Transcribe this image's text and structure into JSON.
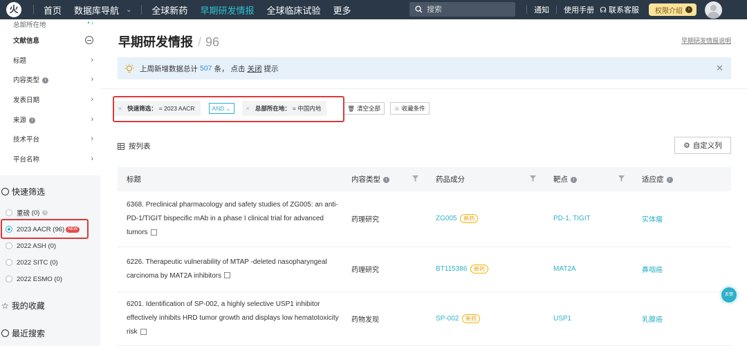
{
  "topnav": {
    "logo": "火",
    "items": [
      "首页",
      "数据库导航",
      "全球新药",
      "早期研发情报",
      "全球临床试验",
      "更多"
    ],
    "active_index": 3,
    "search_placeholder": "搜索",
    "right_items": [
      "通知",
      "使用手册",
      "联系客服"
    ],
    "privilege_label": "权限介绍"
  },
  "sidebar": {
    "top_item": "总部所在地",
    "doc_section": "文献信息",
    "rows": [
      "标题",
      "内容类型",
      "发表日期",
      "来源",
      "技术平台",
      "平台名称"
    ],
    "quick_filter_title": "快速筛选",
    "radios": [
      {
        "label": "重磅",
        "count": "(0)"
      },
      {
        "label": "2023 AACR",
        "count": "(96)",
        "badge": "NEW"
      },
      {
        "label": "2022 ASH",
        "count": "(0)"
      },
      {
        "label": "2022 SITC",
        "count": "(0)"
      },
      {
        "label": "2022 ESMO",
        "count": "(0)"
      }
    ],
    "favorites_title": "我的收藏",
    "recent_title": "最近搜索"
  },
  "main": {
    "title": "早期研发情报",
    "count": "96",
    "help_link": "早期研发情报说明",
    "notice": {
      "prefix": "上周新增数据总计",
      "number": "507",
      "mid": "条， 点击",
      "close": "关闭",
      "suffix": "提示"
    },
    "filters": {
      "chip1_label": "快速筛选：",
      "chip1_value": "= 2023 AACR",
      "operator": "AND",
      "chip2_label": "总部所在地：",
      "chip2_value": "= 中国内地",
      "clear_all": "清空全部",
      "save_filter": "收藏条件"
    },
    "list_label": "按列表",
    "custom_columns": "自定义列"
  },
  "table": {
    "headers": [
      "标题",
      "内容类型",
      "药品成分",
      "靶点",
      "适应症"
    ],
    "rows": [
      {
        "title": "6368. Preclinical pharmacology and safety studies of ZG005: an anti-PD-1/TIGIT bispecific mAb in a phase I clinical trial for advanced tumors",
        "content_type": "药理研究",
        "drug": "ZG005",
        "drug_tag": "新药",
        "target": "PD-1, TIGIT",
        "indication": "实体瘤"
      },
      {
        "title": "6226. Therapeutic vulnerability of MTAP -deleted nasopharyngeal carcinoma by MAT2A inhibitors",
        "content_type": "药理研究",
        "drug": "BT115386",
        "drug_tag": "新药",
        "target": "MAT2A",
        "indication": "鼻咽癌"
      },
      {
        "title": "6201. Identification of SP-002, a highly selective USP1 inhibitor effectively inhibits HRD tumor growth and displays low hematotoxicity risk",
        "content_type": "药物发现",
        "drug": "SP-002",
        "drug_tag": "新药",
        "target": "USP1",
        "indication": "乳腺癌"
      }
    ]
  },
  "float_button": "反馈",
  "colors": {
    "nav_bg": "#2b3848",
    "accent": "#2eb1c8",
    "highlight_box": "#d93a3a"
  }
}
